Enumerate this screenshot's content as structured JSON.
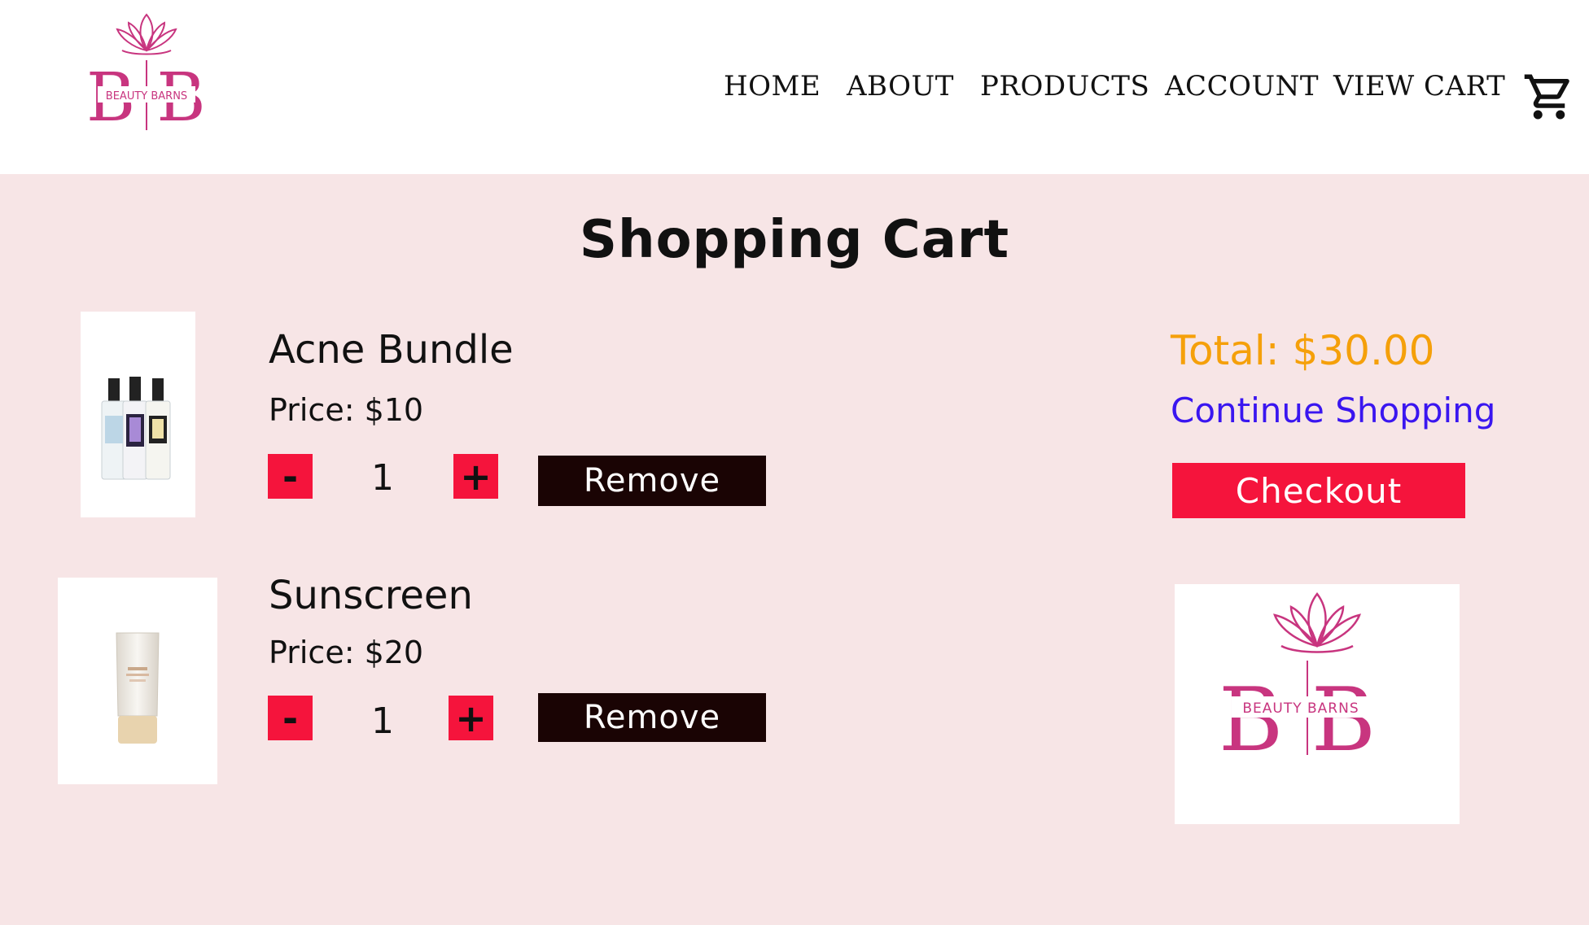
{
  "brand": {
    "logo_text": "BEAUTY BARNS",
    "logo_letters": "B B",
    "color": "#c8357f"
  },
  "nav": {
    "items": [
      "HOME",
      "ABOUT",
      "PRODUCTS",
      "ACCOUNT",
      "VIEW CART"
    ],
    "cart_icon": "shopping-cart-icon"
  },
  "page": {
    "title": "Shopping Cart"
  },
  "cart": {
    "items": [
      {
        "name": "Acne Bundle",
        "price": "Price: $10",
        "quantity": "1",
        "minus_label": "-",
        "plus_label": "+",
        "remove_label": "Remove",
        "image": "serum-bottles-image"
      },
      {
        "name": "Sunscreen",
        "price": "Price: $20",
        "quantity": "1",
        "minus_label": "-",
        "plus_label": "+",
        "remove_label": "Remove",
        "image": "sunscreen-tube-image"
      }
    ]
  },
  "summary": {
    "total": "Total: $30.00",
    "continue_label": "Continue Shopping",
    "checkout_label": "Checkout"
  },
  "colors": {
    "page_background": "#f7e5e6",
    "header_background": "#ffffff",
    "accent_red": "#f5143c",
    "remove_dark": "#1a0404",
    "total_orange": "#f5a00a",
    "link_blue": "#3a16f0"
  }
}
